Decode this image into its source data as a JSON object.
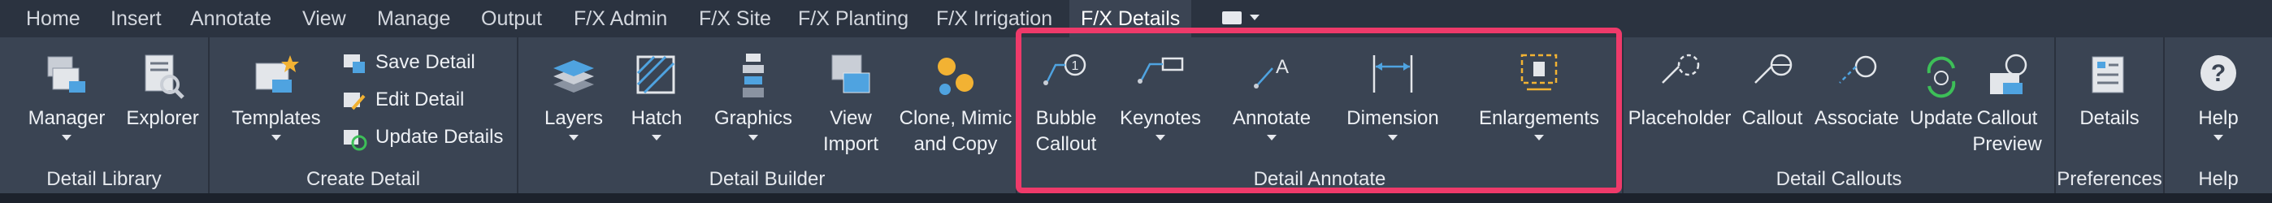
{
  "tabs": [
    "Home",
    "Insert",
    "Annotate",
    "View",
    "Manage",
    "Output",
    "F/X Admin",
    "F/X Site",
    "F/X Planting",
    "F/X Irrigation",
    "F/X Details"
  ],
  "active_tab": "F/X Details",
  "panels": {
    "detail_library": {
      "title": "Detail Library",
      "manager": "Manager",
      "explorer": "Explorer"
    },
    "create_detail": {
      "title": "Create Detail",
      "templates": "Templates",
      "save": "Save Detail",
      "edit": "Edit Detail",
      "update": "Update Details"
    },
    "detail_builder": {
      "title": "Detail Builder",
      "layers": "Layers",
      "hatch": "Hatch",
      "graphics": "Graphics",
      "view_import_1": "View",
      "view_import_2": "Import",
      "clone_1": "Clone, Mimic",
      "clone_2": "and Copy"
    },
    "detail_annotate": {
      "title": "Detail Annotate",
      "bubble_1": "Bubble",
      "bubble_2": "Callout",
      "keynotes": "Keynotes",
      "annotate": "Annotate",
      "dimension": "Dimension",
      "enlargements": "Enlargements"
    },
    "detail_callouts": {
      "title": "Detail Callouts",
      "placeholder": "Placeholder",
      "callout": "Callout",
      "associate": "Associate",
      "update": "Update",
      "preview_1": "Callout",
      "preview_2": "Preview"
    },
    "preferences": {
      "title": "Preferences",
      "details": "Details"
    },
    "help": {
      "title": "Help",
      "help": "Help"
    }
  },
  "colors": {
    "accent_highlight": "#ee3a6a",
    "ribbon_bg": "#3a4453",
    "tab_bg": "#2b3340"
  }
}
